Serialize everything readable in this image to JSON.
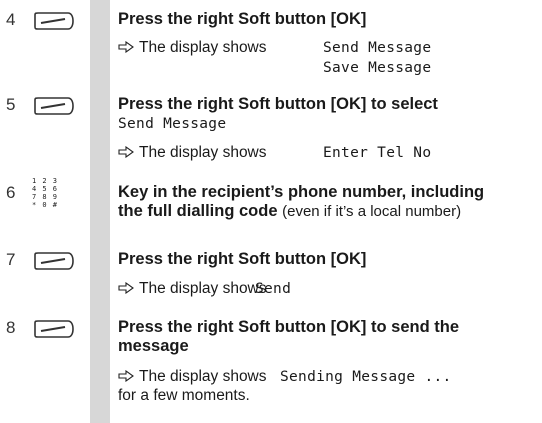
{
  "steps": [
    {
      "number": "4",
      "icon": "soft-button-icon",
      "instruction": "Press the right Soft button [OK]",
      "result_prefix": "The display shows",
      "display_lines": [
        "Send Message",
        "Save Message"
      ]
    },
    {
      "number": "5",
      "icon": "soft-button-icon",
      "instruction": "Press the right Soft button [OK] to select",
      "instruction_display": "Send Message",
      "result_prefix": "The display shows",
      "display_text": "Enter Tel No"
    },
    {
      "number": "6",
      "icon": "keypad-icon",
      "keypad_rows": [
        "1 2 3",
        "4 5 6",
        "7 8 9",
        "* 0 #"
      ],
      "instruction_line1": "Key in the recipient’s phone number, including",
      "instruction_line2": "the full dialling code",
      "note": "(even if it’s a local number)"
    },
    {
      "number": "7",
      "icon": "soft-button-icon",
      "instruction": "Press the right Soft button [OK]",
      "result_prefix": "The display shows",
      "display_text": "Send"
    },
    {
      "number": "8",
      "icon": "soft-button-icon",
      "instruction_line1": "Press the right Soft button [OK] to send the",
      "instruction_line2": "message",
      "result_prefix": "The display shows",
      "display_text": "Sending Message ...",
      "result_suffix": "for a few moments."
    }
  ]
}
